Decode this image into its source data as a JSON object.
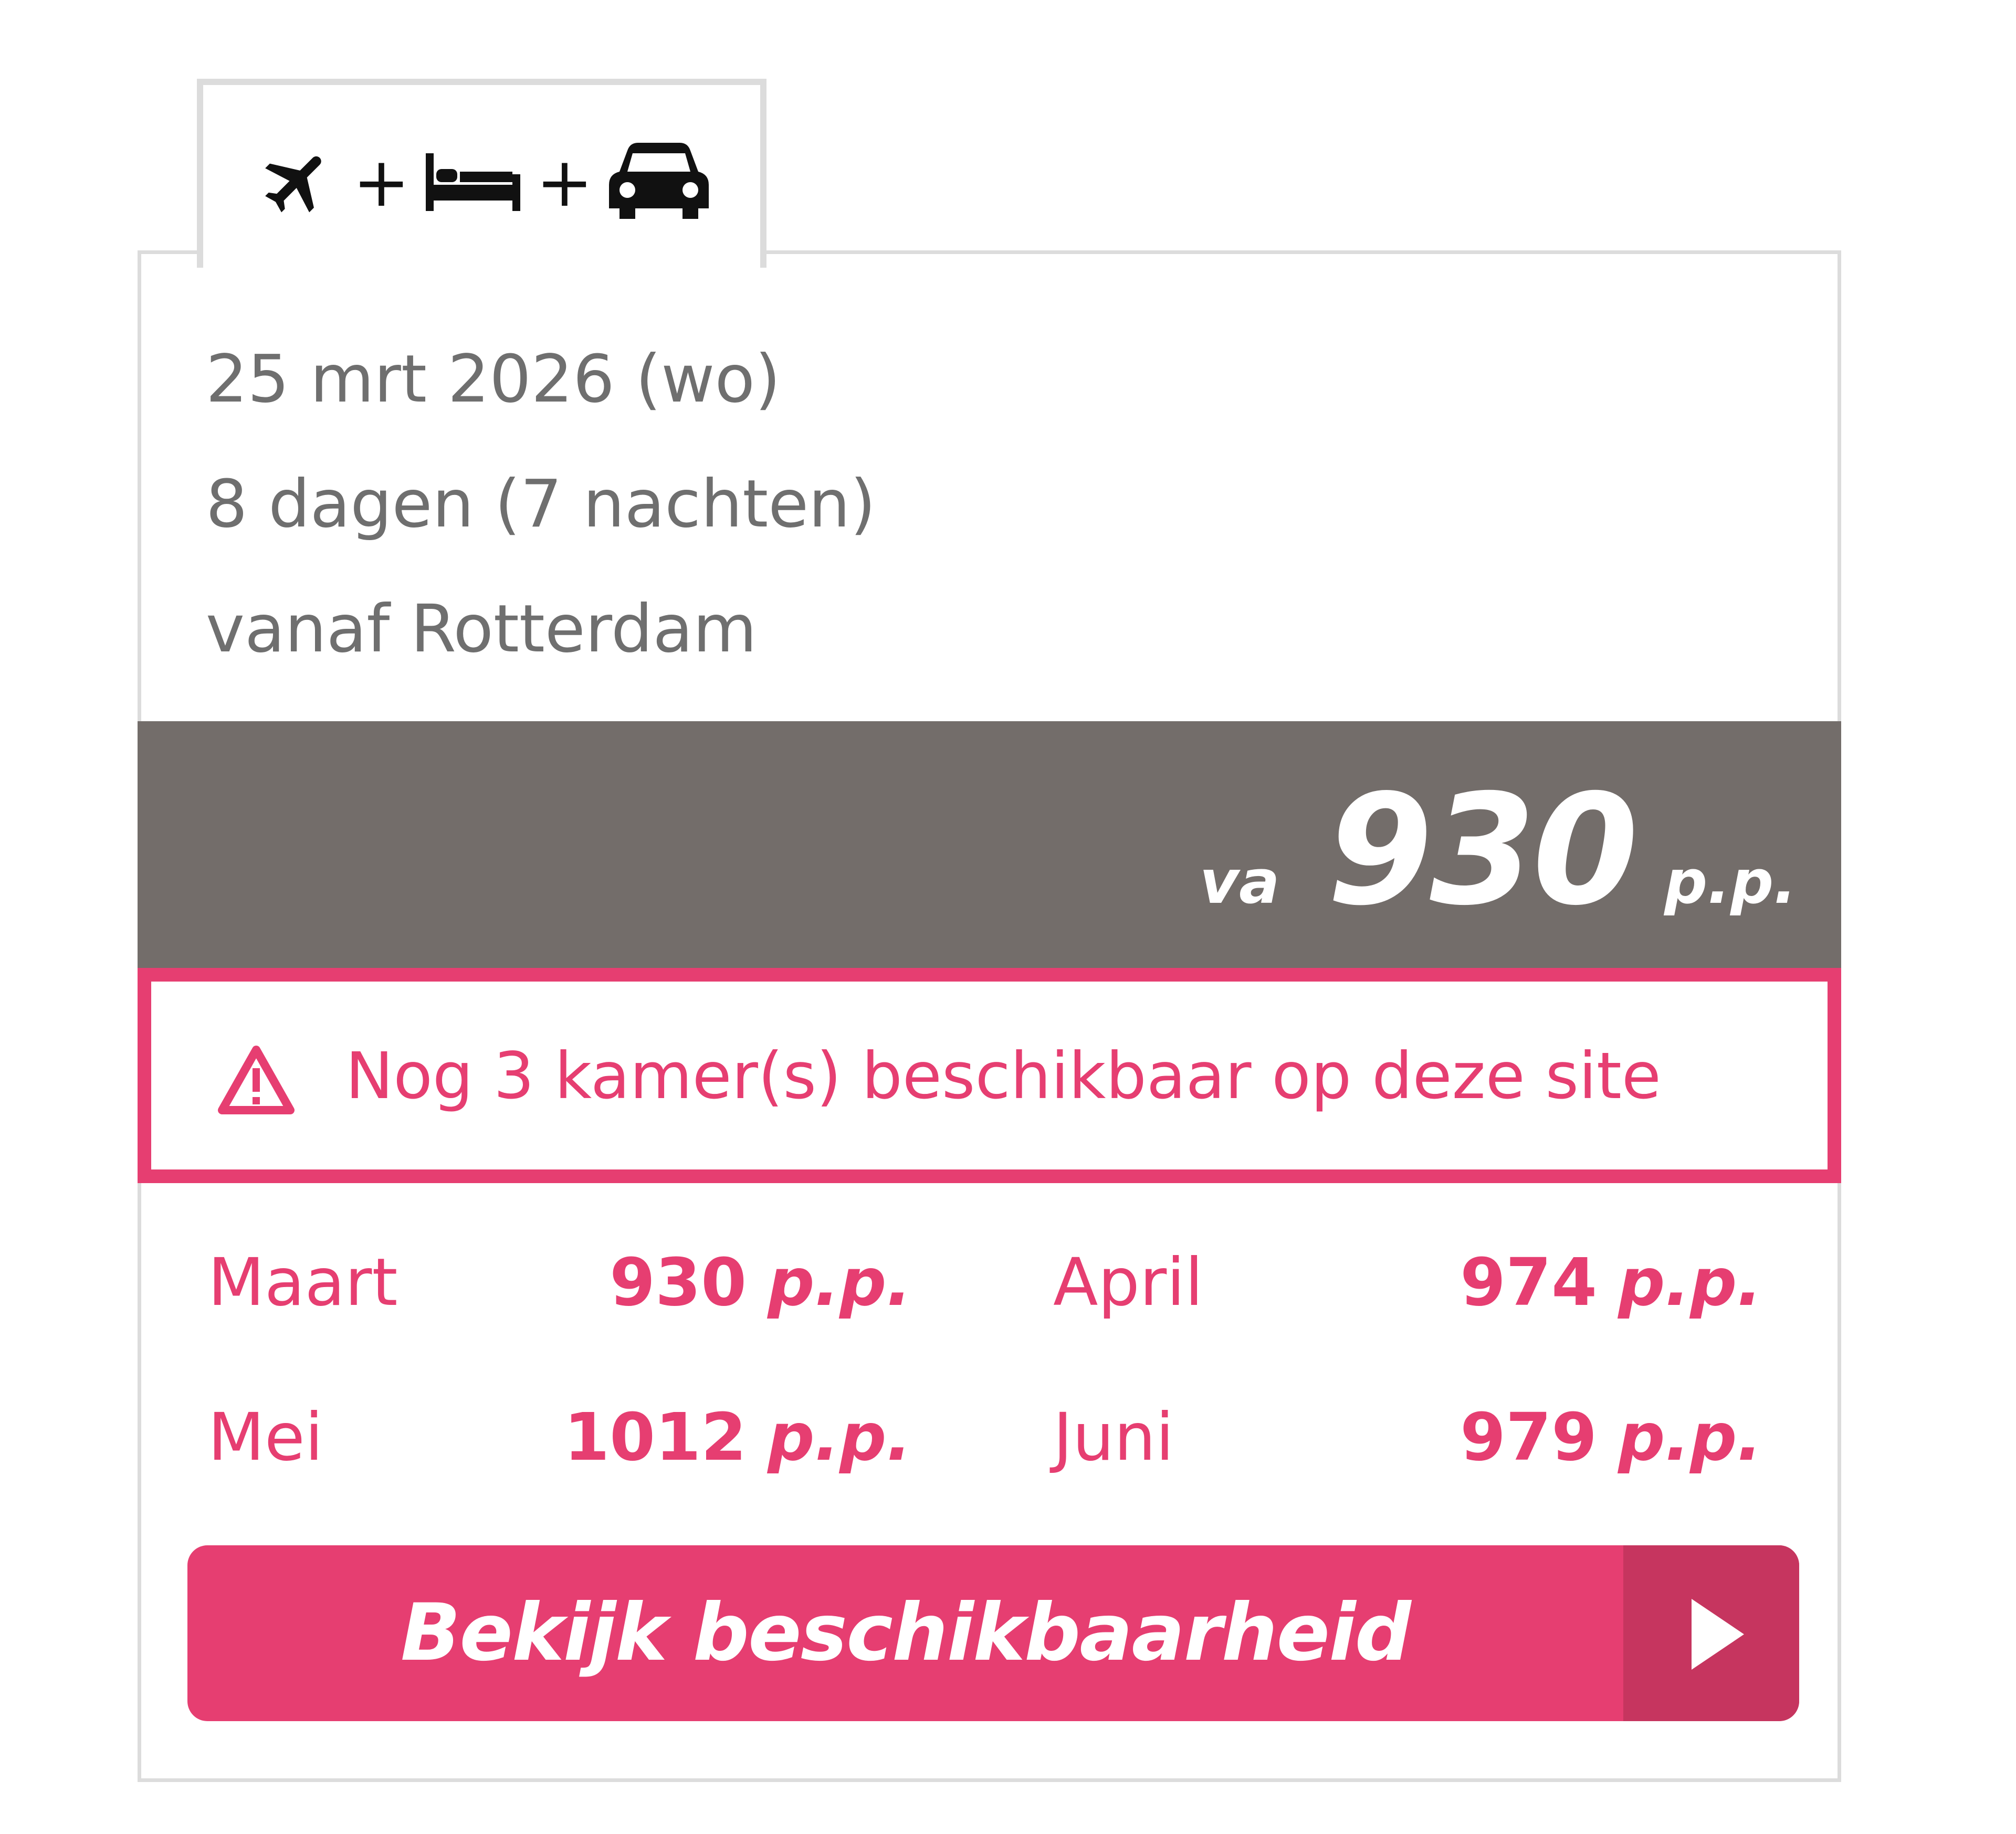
{
  "tab": {
    "icons": [
      "airplane-icon",
      "bed-icon",
      "car-icon"
    ],
    "separator": "+"
  },
  "trip": {
    "date": "25 mrt 2026 (wo)",
    "duration": "8 dagen (7 nachten)",
    "departure": "vanaf Rotterdam"
  },
  "price": {
    "prefix": "va",
    "amount": "930",
    "suffix": "p.p."
  },
  "availability": {
    "icon": "warning-icon",
    "text": "Nog 3 kamer(s) beschikbaar op deze site"
  },
  "months": [
    {
      "name": "Maart",
      "price": "930",
      "unit": "p.p."
    },
    {
      "name": "April",
      "price": "974",
      "unit": "p.p."
    },
    {
      "name": "Mei",
      "price": "1012",
      "unit": "p.p."
    },
    {
      "name": "Juni",
      "price": "979",
      "unit": "p.p."
    }
  ],
  "cta": {
    "label": "Bekijk beschikbaarheid",
    "icon": "play-arrow-icon"
  },
  "colors": {
    "accent": "#e63e71",
    "accent_dark": "#c6355f",
    "price_bar": "#736d6a",
    "border": "#dcdcdc",
    "text_muted": "#6f6f6f"
  }
}
